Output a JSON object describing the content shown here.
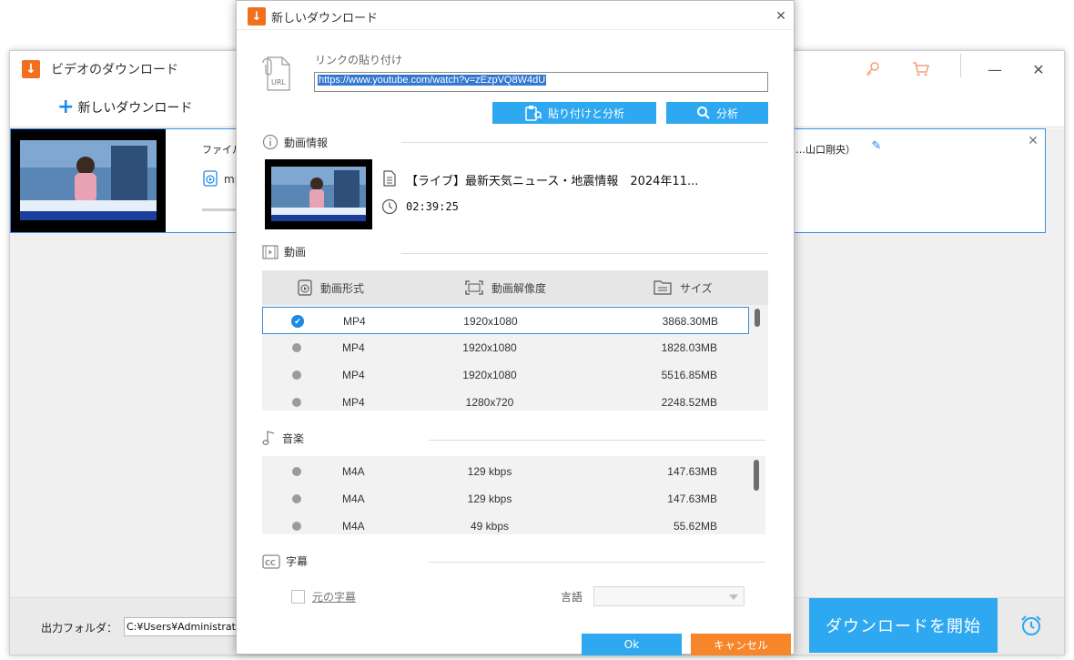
{
  "main_window": {
    "title": "ビデオのダウンロード",
    "new_download_label": "新しいダウンロード",
    "task": {
      "file_label": "ファイル名",
      "file_label_tail": "…山口剛央）",
      "format_label": "mp"
    },
    "output_folder_label": "出力フォルダ：",
    "output_folder_path": "C:¥Users¥Administrator¥",
    "start_button_label": "ダウンロードを開始"
  },
  "dialog": {
    "title": "新しいダウンロード",
    "link_label": "リンクの貼り付け",
    "url_value": "https://www.youtube.com/watch?v=zEzpVQ8W4dU",
    "paste_analyze_label": "貼り付けと分析",
    "analyze_label": "分析",
    "video_info_label": "動画情報",
    "video_title": "【ライブ】最新天気ニュース・地震情報　2024年11...",
    "duration": "02:39:25",
    "video_section_label": "動画",
    "video_columns": {
      "format": "動画形式",
      "resolution": "動画解像度",
      "size": "サイズ"
    },
    "video_rows": [
      {
        "format": "MP4",
        "resolution": "1920x1080",
        "size": "3868.30MB",
        "selected": true
      },
      {
        "format": "MP4",
        "resolution": "1920x1080",
        "size": "1828.03MB",
        "selected": false
      },
      {
        "format": "MP4",
        "resolution": "1920x1080",
        "size": "5516.85MB",
        "selected": false
      },
      {
        "format": "MP4",
        "resolution": "1280x720",
        "size": "2248.52MB",
        "selected": false
      }
    ],
    "audio_section_label": "音楽",
    "audio_rows": [
      {
        "format": "M4A",
        "bitrate": "129 kbps",
        "size": "147.63MB"
      },
      {
        "format": "M4A",
        "bitrate": "129 kbps",
        "size": "147.63MB"
      },
      {
        "format": "M4A",
        "bitrate": "49 kbps",
        "size": "55.62MB"
      }
    ],
    "subtitle_section_label": "字幕",
    "original_subtitle_label": "元の字幕",
    "language_label": "言語",
    "language_value": "",
    "ok_label": "Ok",
    "cancel_label": "キャンセル"
  },
  "colors": {
    "accent_blue": "#2ea8f0",
    "select_blue": "#1e88e5",
    "cancel_orange": "#f7862b",
    "app_icon_orange": "#f07020"
  }
}
